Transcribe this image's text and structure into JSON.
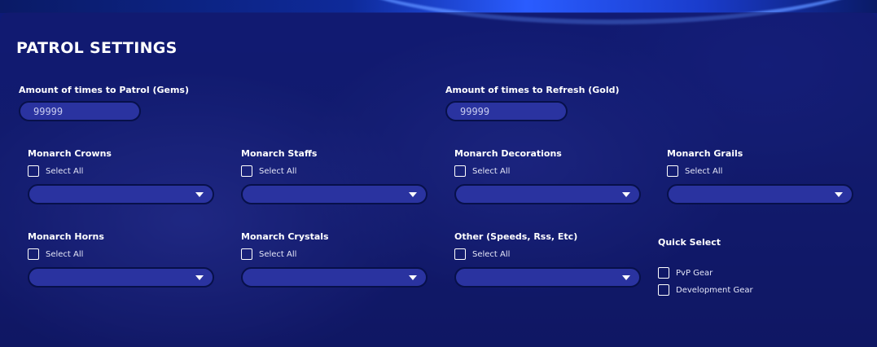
{
  "panel": {
    "title": "PATROL SETTINGS"
  },
  "patrol": {
    "label": "Amount of times to Patrol (Gems)",
    "value": "99999"
  },
  "refresh": {
    "label": "Amount of times to Refresh (Gold)",
    "value": "99999"
  },
  "categories": [
    {
      "label": "Monarch Crowns",
      "select_all": "Select All"
    },
    {
      "label": "Monarch Staffs",
      "select_all": "Select All"
    },
    {
      "label": "Monarch Decorations",
      "select_all": "Select All"
    },
    {
      "label": "Monarch Grails",
      "select_all": "Select All"
    },
    {
      "label": "Monarch Horns",
      "select_all": "Select All"
    },
    {
      "label": "Monarch Crystals",
      "select_all": "Select All"
    },
    {
      "label": "Other (Speeds, Rss, Etc)",
      "select_all": "Select All"
    }
  ],
  "quick_select": {
    "label": "Quick Select",
    "options": [
      "PvP Gear",
      "Development Gear"
    ]
  },
  "colors": {
    "background": "#0e1a78",
    "field": "#2a33a0",
    "field_border": "#07104a",
    "text": "#ffffff"
  }
}
